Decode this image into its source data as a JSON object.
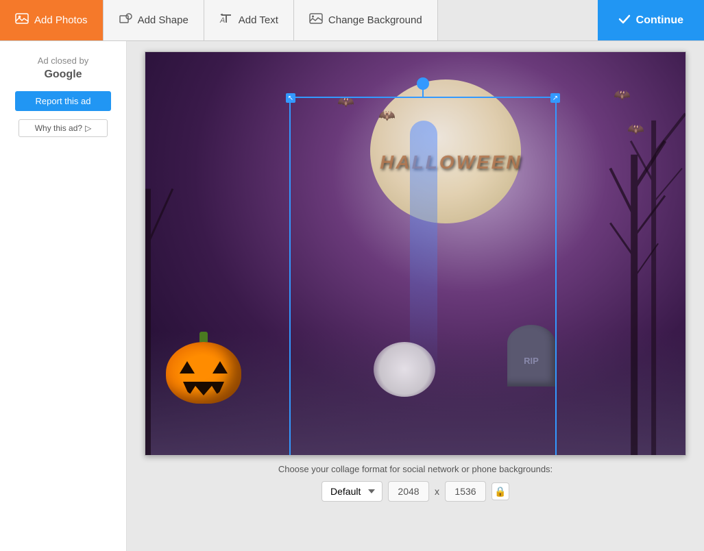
{
  "toolbar": {
    "add_photos_label": "Add Photos",
    "add_shape_label": "Add Shape",
    "add_text_label": "Add Text",
    "change_background_label": "Change Background",
    "continue_label": "Continue"
  },
  "sidebar": {
    "ad_closed_line1": "Ad closed by",
    "ad_closed_google": "Google",
    "report_btn_label": "Report this ad",
    "why_ad_label": "Why this ad?"
  },
  "format_bar": {
    "label": "Choose your collage format for social network or phone backgrounds:",
    "default_option": "Default",
    "width": "2048",
    "x_label": "x",
    "height": "1536"
  },
  "selection": {
    "rotate_handle": "rotate",
    "move_handle": "move"
  },
  "tombstone": {
    "text": "RIP"
  }
}
